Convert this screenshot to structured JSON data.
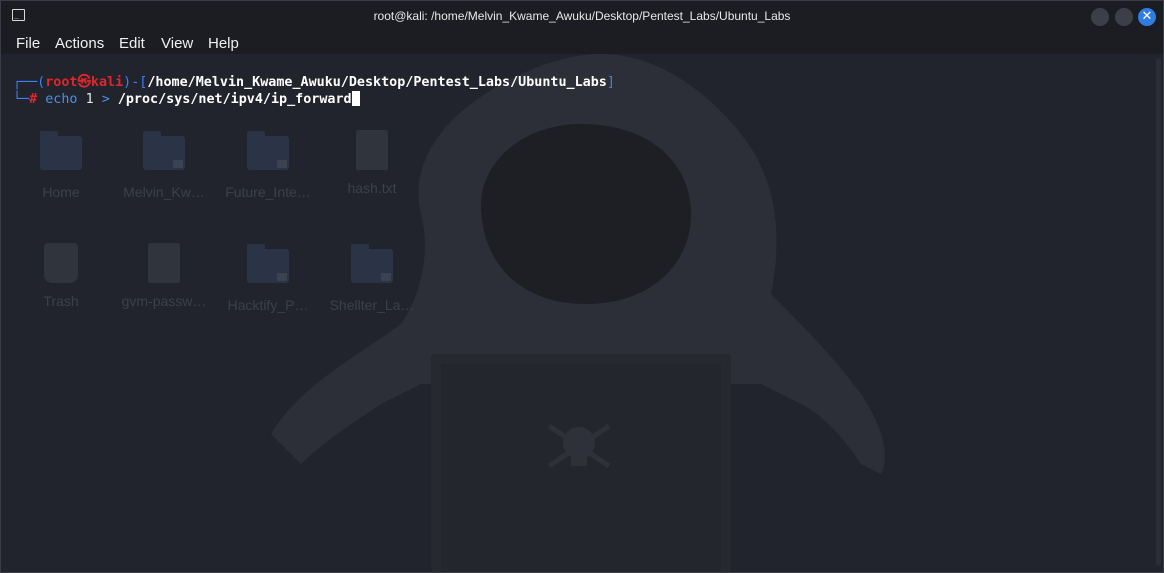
{
  "window": {
    "title": "root@kali: /home/Melvin_Kwame_Awuku/Desktop/Pentest_Labs/Ubuntu_Labs",
    "close_symbol": "✕"
  },
  "menu": {
    "items": [
      "File",
      "Actions",
      "Edit",
      "View",
      "Help"
    ]
  },
  "desktop": {
    "icons": [
      {
        "label": "Home",
        "icon": "home-folder-icon"
      },
      {
        "label": "Melvin_Kw…",
        "icon": "folder-icon"
      },
      {
        "label": "Future_Inte…",
        "icon": "folder-icon"
      },
      {
        "label": "hash.txt",
        "icon": "text-file-icon"
      },
      {
        "label": "Trash",
        "icon": "trash-icon"
      },
      {
        "label": "gvm-passw…",
        "icon": "text-file-icon"
      },
      {
        "label": "Hacktify_P…",
        "icon": "folder-icon"
      },
      {
        "label": "Shellter_La…",
        "icon": "folder-icon"
      }
    ]
  },
  "terminal": {
    "prompt": {
      "corner_top": "┌──(",
      "user": "root",
      "at": "㉿",
      "host": "kali",
      "mid": ")-[",
      "path": "/home/Melvin_Kwame_Awuku/Desktop/Pentest_Labs/Ubuntu_Labs",
      "close": "]",
      "corner_bottom": "└─",
      "symbol": "#"
    },
    "command": {
      "cmd": "echo",
      "arg1": "1",
      "redirect": ">",
      "target": "/proc/sys/net/ipv4/ip_forward"
    }
  },
  "colors": {
    "prompt_blue": "#3b82f6",
    "prompt_red": "#e0262d",
    "close_button": "#2f7de1"
  }
}
